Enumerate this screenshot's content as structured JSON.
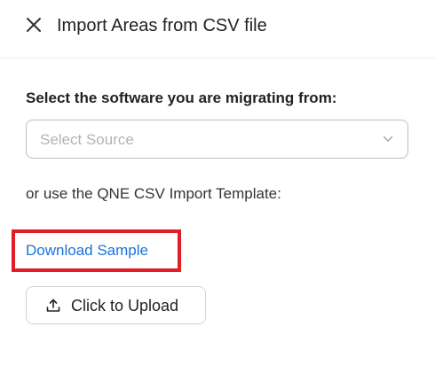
{
  "header": {
    "title": "Import Areas from CSV file",
    "close_icon": "close-icon"
  },
  "source": {
    "label": "Select the software you are migrating from:",
    "placeholder": "Select Source",
    "chevron_icon": "chevron-down-icon"
  },
  "template": {
    "text": "or use the QNE CSV Import Template:",
    "download_link": "Download Sample",
    "highlight_color": "#e11d26",
    "link_color": "#1a73d9"
  },
  "upload": {
    "label": "Click to Upload",
    "icon": "upload-icon"
  }
}
